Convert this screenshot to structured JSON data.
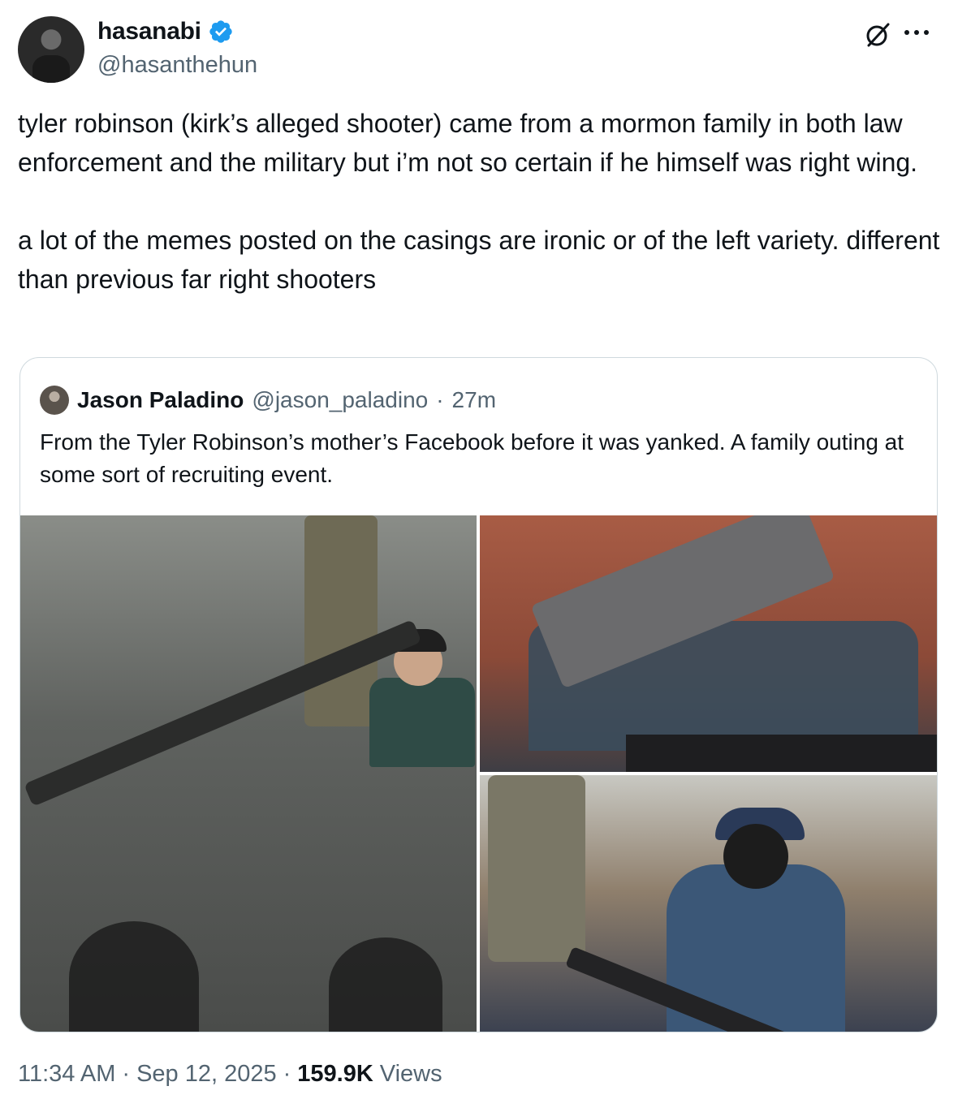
{
  "author": {
    "display_name": "hasanabi",
    "handle": "@hasanthehun",
    "verified_color": "#1d9bf0"
  },
  "icons": {
    "grok": "grok-icon",
    "more": "more-icon",
    "verified": "verified-badge-icon"
  },
  "tweet": {
    "paragraph_1": "tyler robinson (kirk’s alleged shooter) came from a mormon family in both law enforcement and the military but i’m not so certain if he himself was right wing.",
    "paragraph_2": "a lot of the memes posted on the casings are ironic or of the left variety. different than previous far right shooters"
  },
  "quote": {
    "display_name": "Jason Paladino",
    "handle": "@jason_paladino",
    "separator": "·",
    "time": "27m",
    "text": "From the Tyler Robinson’s mother’s Facebook before it was yanked. A family outing at some sort of recruiting event.",
    "photo_count": 3
  },
  "footer": {
    "time": "11:34 AM",
    "dot1": "·",
    "date": "Sep 12, 2025",
    "dot2": "·",
    "views_count": "159.9K",
    "views_label": "Views"
  }
}
